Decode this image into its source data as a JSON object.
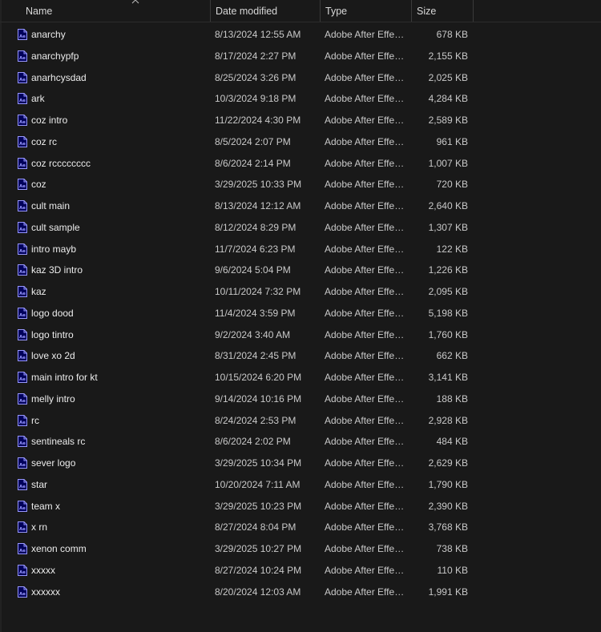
{
  "columns": {
    "name": "Name",
    "date": "Date modified",
    "type": "Type",
    "size": "Size"
  },
  "sort": {
    "column": "name",
    "direction": "ascending",
    "icon": "chevron-up-icon"
  },
  "file_icon": {
    "name": "after-effects-file-icon",
    "color": "#9999ff",
    "bg": "#00005b"
  },
  "files": [
    {
      "name": "anarchy",
      "date": "8/13/2024 12:55 AM",
      "type": "Adobe After Effects Project",
      "size": "678 KB"
    },
    {
      "name": "anarchypfp",
      "date": "8/17/2024 2:27 PM",
      "type": "Adobe After Effects Project",
      "size": "2,155 KB"
    },
    {
      "name": "anarhcysdad",
      "date": "8/25/2024 3:26 PM",
      "type": "Adobe After Effects Project",
      "size": "2,025 KB"
    },
    {
      "name": "ark",
      "date": "10/3/2024 9:18 PM",
      "type": "Adobe After Effects Project",
      "size": "4,284 KB"
    },
    {
      "name": "coz intro",
      "date": "11/22/2024 4:30 PM",
      "type": "Adobe After Effects Project",
      "size": "2,589 KB"
    },
    {
      "name": "coz rc",
      "date": "8/5/2024 2:07 PM",
      "type": "Adobe After Effects Project",
      "size": "961 KB"
    },
    {
      "name": "coz rcccccccc",
      "date": "8/6/2024 2:14 PM",
      "type": "Adobe After Effects Project",
      "size": "1,007 KB"
    },
    {
      "name": "coz",
      "date": "3/29/2025 10:33 PM",
      "type": "Adobe After Effects Project",
      "size": "720 KB"
    },
    {
      "name": "cult main",
      "date": "8/13/2024 12:12 AM",
      "type": "Adobe After Effects Project",
      "size": "2,640 KB"
    },
    {
      "name": "cult sample",
      "date": "8/12/2024 8:29 PM",
      "type": "Adobe After Effects Project",
      "size": "1,307 KB"
    },
    {
      "name": "intro mayb",
      "date": "11/7/2024 6:23 PM",
      "type": "Adobe After Effects Project",
      "size": "122 KB"
    },
    {
      "name": "kaz 3D intro",
      "date": "9/6/2024 5:04 PM",
      "type": "Adobe After Effects Project",
      "size": "1,226 KB"
    },
    {
      "name": "kaz",
      "date": "10/11/2024 7:32 PM",
      "type": "Adobe After Effects Project",
      "size": "2,095 KB"
    },
    {
      "name": "logo dood",
      "date": "11/4/2024 3:59 PM",
      "type": "Adobe After Effects Project",
      "size": "5,198 KB"
    },
    {
      "name": "logo tintro",
      "date": "9/2/2024 3:40 AM",
      "type": "Adobe After Effects Project",
      "size": "1,760 KB"
    },
    {
      "name": "love xo 2d",
      "date": "8/31/2024 2:45 PM",
      "type": "Adobe After Effects Project",
      "size": "662 KB"
    },
    {
      "name": "main intro for kt",
      "date": "10/15/2024 6:20 PM",
      "type": "Adobe After Effects Project",
      "size": "3,141 KB"
    },
    {
      "name": "melly intro",
      "date": "9/14/2024 10:16 PM",
      "type": "Adobe After Effects Project",
      "size": "188 KB"
    },
    {
      "name": "rc",
      "date": "8/24/2024 2:53 PM",
      "type": "Adobe After Effects Project",
      "size": "2,928 KB"
    },
    {
      "name": "sentineals rc",
      "date": "8/6/2024 2:02 PM",
      "type": "Adobe After Effects Project",
      "size": "484 KB"
    },
    {
      "name": "sever logo",
      "date": "3/29/2025 10:34 PM",
      "type": "Adobe After Effects Project",
      "size": "2,629 KB"
    },
    {
      "name": "star",
      "date": "10/20/2024 7:11 AM",
      "type": "Adobe After Effects Project",
      "size": "1,790 KB"
    },
    {
      "name": "team x",
      "date": "3/29/2025 10:23 PM",
      "type": "Adobe After Effects Project",
      "size": "2,390 KB"
    },
    {
      "name": "x rn",
      "date": "8/27/2024 8:04 PM",
      "type": "Adobe After Effects Project",
      "size": "3,768 KB"
    },
    {
      "name": "xenon comm",
      "date": "3/29/2025 10:27 PM",
      "type": "Adobe After Effects Project",
      "size": "738 KB"
    },
    {
      "name": "xxxxx",
      "date": "8/27/2024 10:24 PM",
      "type": "Adobe After Effects Project",
      "size": "110 KB"
    },
    {
      "name": "xxxxxx",
      "date": "8/20/2024 12:03 AM",
      "type": "Adobe After Effects Project",
      "size": "1,991 KB"
    }
  ]
}
